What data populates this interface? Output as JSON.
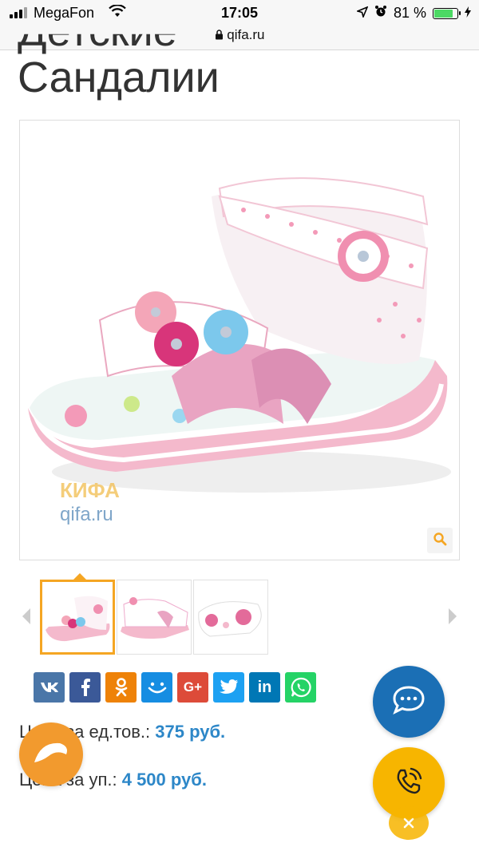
{
  "statusbar": {
    "carrier": "MegaFon",
    "time": "17:05",
    "battery_percent": "81 %",
    "battery_level": 0.81,
    "url": "qifa.ru"
  },
  "product": {
    "title_line1": "Детские",
    "title_line2": "Сандалии",
    "watermark_brand": "КИФА",
    "watermark_url": "qifa.ru"
  },
  "social": [
    {
      "name": "vk-share-button",
      "label": "vk",
      "color": "#4a76a8"
    },
    {
      "name": "facebook-share-button",
      "label": "f",
      "color": "#3b5998"
    },
    {
      "name": "odnoklassniki-share-button",
      "label": "ok",
      "color": "#ee8208"
    },
    {
      "name": "moimir-share-button",
      "label": "mm",
      "color": "#168de2"
    },
    {
      "name": "googleplus-share-button",
      "label": "G+",
      "color": "#dd4b39"
    },
    {
      "name": "twitter-share-button",
      "label": "tw",
      "color": "#1da1f2"
    },
    {
      "name": "linkedin-share-button",
      "label": "in",
      "color": "#0077b5"
    },
    {
      "name": "whatsapp-share-button",
      "label": "wa",
      "color": "#25d366"
    }
  ],
  "prices": {
    "unit_label": "Цена за ед.тов.:",
    "unit_value": "375 руб.",
    "pack_label": "Цена за уп.:",
    "pack_value": "4 500 руб."
  },
  "icons": {
    "zoom": "search-icon",
    "chat": "chat-bubble-icon",
    "call": "phone-call-icon",
    "close": "close-icon"
  }
}
